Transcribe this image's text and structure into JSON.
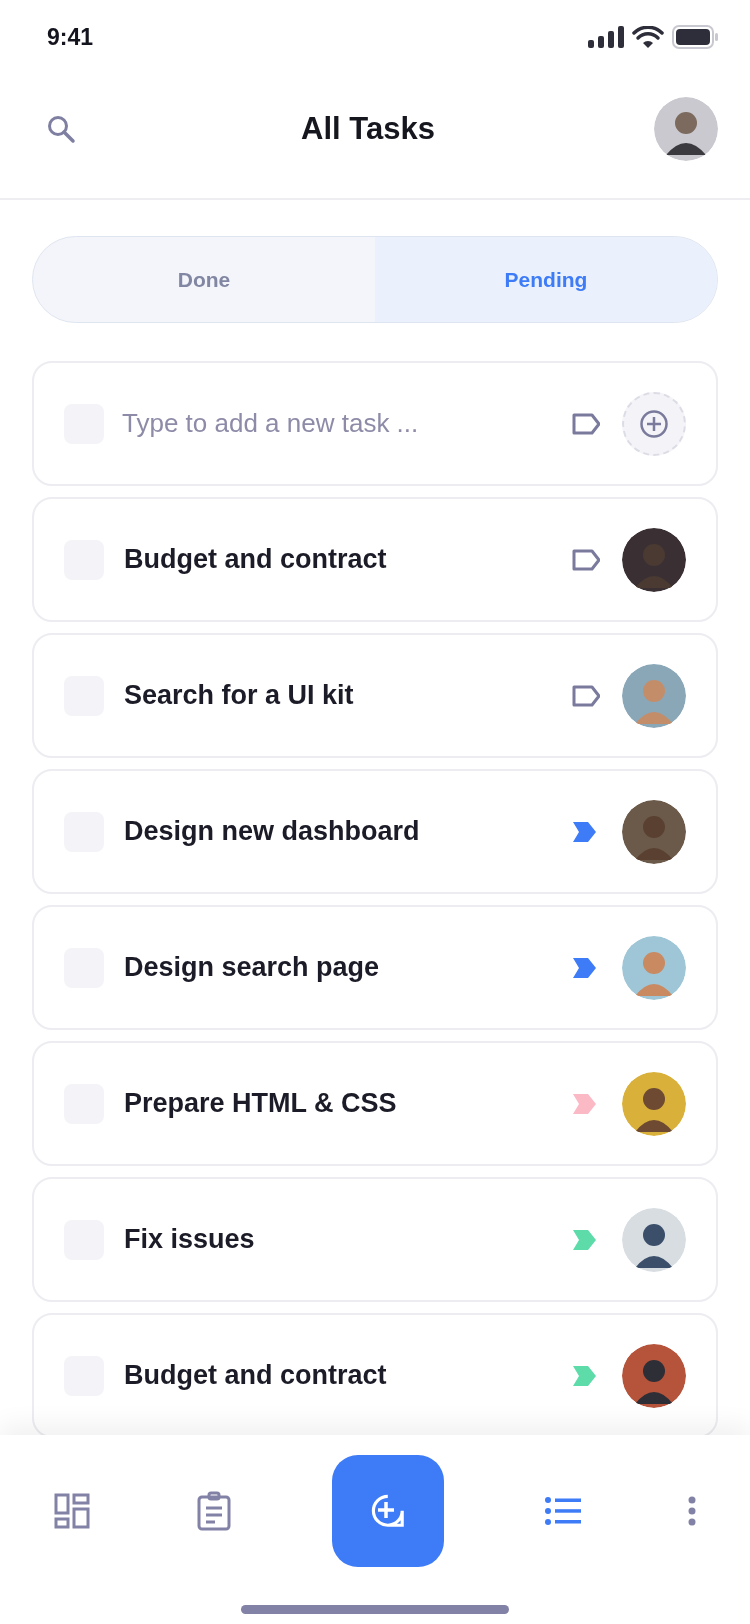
{
  "status_bar": {
    "time": "9:41"
  },
  "header": {
    "title": "All Tasks"
  },
  "tabs": [
    {
      "label": "Done",
      "selected": false
    },
    {
      "label": "Pending",
      "selected": true
    }
  ],
  "new_task": {
    "placeholder": "Type to add a new task ...",
    "checked": false
  },
  "tasks": [
    {
      "title": "Budget and contract",
      "checked": false,
      "tag": {
        "kind": "outline",
        "color": "#7a7a9d"
      }
    },
    {
      "title": "Search for a UI kit",
      "checked": false,
      "tag": {
        "kind": "outline",
        "color": "#7a7a9d"
      }
    },
    {
      "title": "Design new dashboard",
      "checked": false,
      "tag": {
        "kind": "filled",
        "color": "#3d7bf7"
      }
    },
    {
      "title": "Design search page",
      "checked": false,
      "tag": {
        "kind": "filled",
        "color": "#3d7bf7"
      }
    },
    {
      "title": "Prepare HTML & CSS",
      "checked": false,
      "tag": {
        "kind": "filled",
        "color": "#fbb8c5"
      }
    },
    {
      "title": "Fix issues",
      "checked": false,
      "tag": {
        "kind": "filled",
        "color": "#5ddca9"
      }
    },
    {
      "title": "Budget and contract",
      "checked": false,
      "tag": {
        "kind": "filled",
        "color": "#5ddca9"
      }
    }
  ],
  "bottom_nav": [
    {
      "kind": "dashboard",
      "selected": false
    },
    {
      "kind": "clipboard",
      "selected": false
    },
    {
      "kind": "add",
      "selected": false
    },
    {
      "kind": "list",
      "selected": true
    },
    {
      "kind": "more",
      "selected": false
    }
  ]
}
